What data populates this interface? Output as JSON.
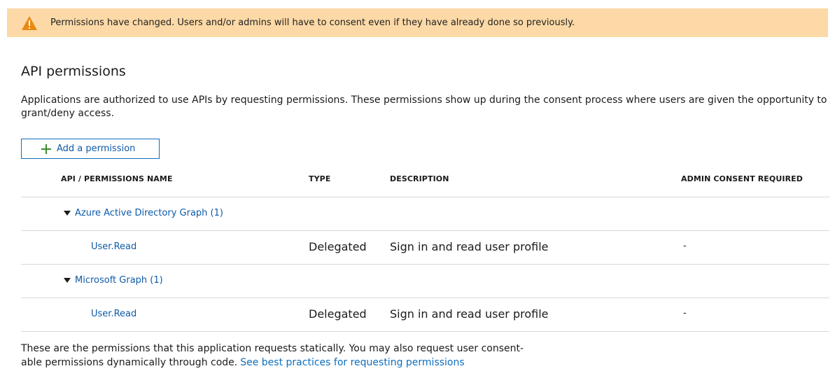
{
  "banner": {
    "icon": "warning-icon",
    "text": "Permissions have changed. Users and/or admins will have to consent even if they have already done so previously.",
    "color": "#fcd9a6",
    "icon_color": "#ea8a12"
  },
  "page": {
    "title": "API permissions",
    "description": "Applications are authorized to use APIs by requesting permissions. These permissions show up during the consent process where users are given the opportunity to grant/deny access."
  },
  "toolbar": {
    "add_label": "Add a permission",
    "add_icon": "plus-icon"
  },
  "table": {
    "columns": {
      "name": "API / PERMISSIONS NAME",
      "type": "TYPE",
      "description": "DESCRIPTION",
      "admin": "ADMIN CONSENT REQUIRED"
    },
    "groups": [
      {
        "label": "Azure Active Directory Graph (1)",
        "permissions": [
          {
            "name": "User.Read",
            "type": "Delegated",
            "description": "Sign in and read user profile",
            "admin": "-"
          }
        ]
      },
      {
        "label": "Microsoft Graph (1)",
        "permissions": [
          {
            "name": "User.Read",
            "type": "Delegated",
            "description": "Sign in and read user profile",
            "admin": "-"
          }
        ]
      }
    ]
  },
  "footer": {
    "text_line1": "These are the permissions that this application requests statically. You may also request user consent-",
    "text_line2": "able permissions dynamically through code.",
    "link": "See best practices for requesting permissions"
  },
  "colors": {
    "link": "#0e5aa7",
    "plus": "#3c8b2e"
  }
}
